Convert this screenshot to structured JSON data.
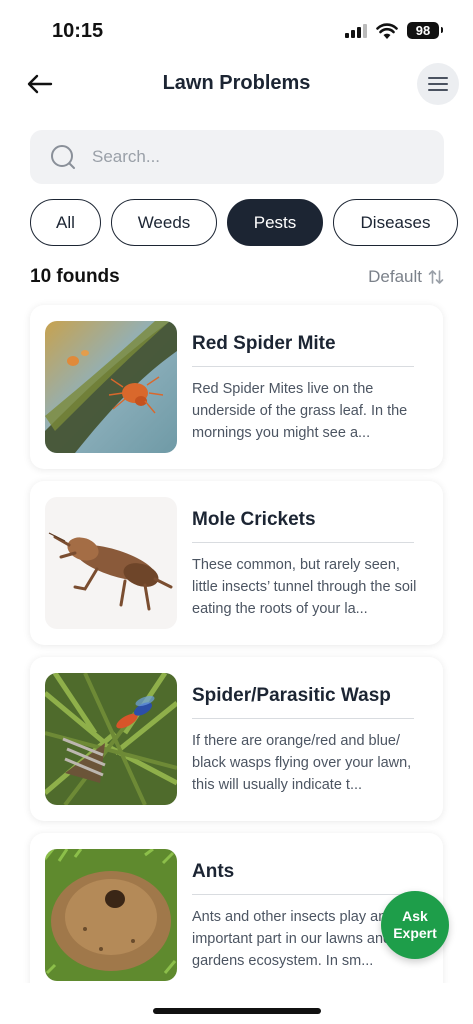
{
  "status_bar": {
    "time": "10:15",
    "battery": "98"
  },
  "header": {
    "title": "Lawn Problems"
  },
  "search": {
    "placeholder": "Search..."
  },
  "tabs": [
    {
      "label": "All",
      "active": false
    },
    {
      "label": "Weeds",
      "active": false
    },
    {
      "label": "Pests",
      "active": true
    },
    {
      "label": "Diseases",
      "active": false
    }
  ],
  "results": {
    "count": "10 founds",
    "sort_label": "Default"
  },
  "items": [
    {
      "title": "Red Spider Mite",
      "description": "Red Spider Mites live on the underside of the grass leaf. In the mornings you might see a..."
    },
    {
      "title": "Mole Crickets",
      "description": "These common, but rarely seen, little insects’ tunnel through the soil eating the roots of your la..."
    },
    {
      "title": "Spider/Parasitic Wasp",
      "description": "If there are orange/red and blue/ black wasps flying over your lawn, this will usually indicate t..."
    },
    {
      "title": "Ants",
      "description": "Ants and other insects play an important part in our lawns and our gardens ecosystem. In sm..."
    }
  ],
  "fab": {
    "label": "Ask\nExpert"
  },
  "colors": {
    "primary": "#1c2533",
    "accent": "#1e9e4a",
    "muted": "#7b818a"
  }
}
